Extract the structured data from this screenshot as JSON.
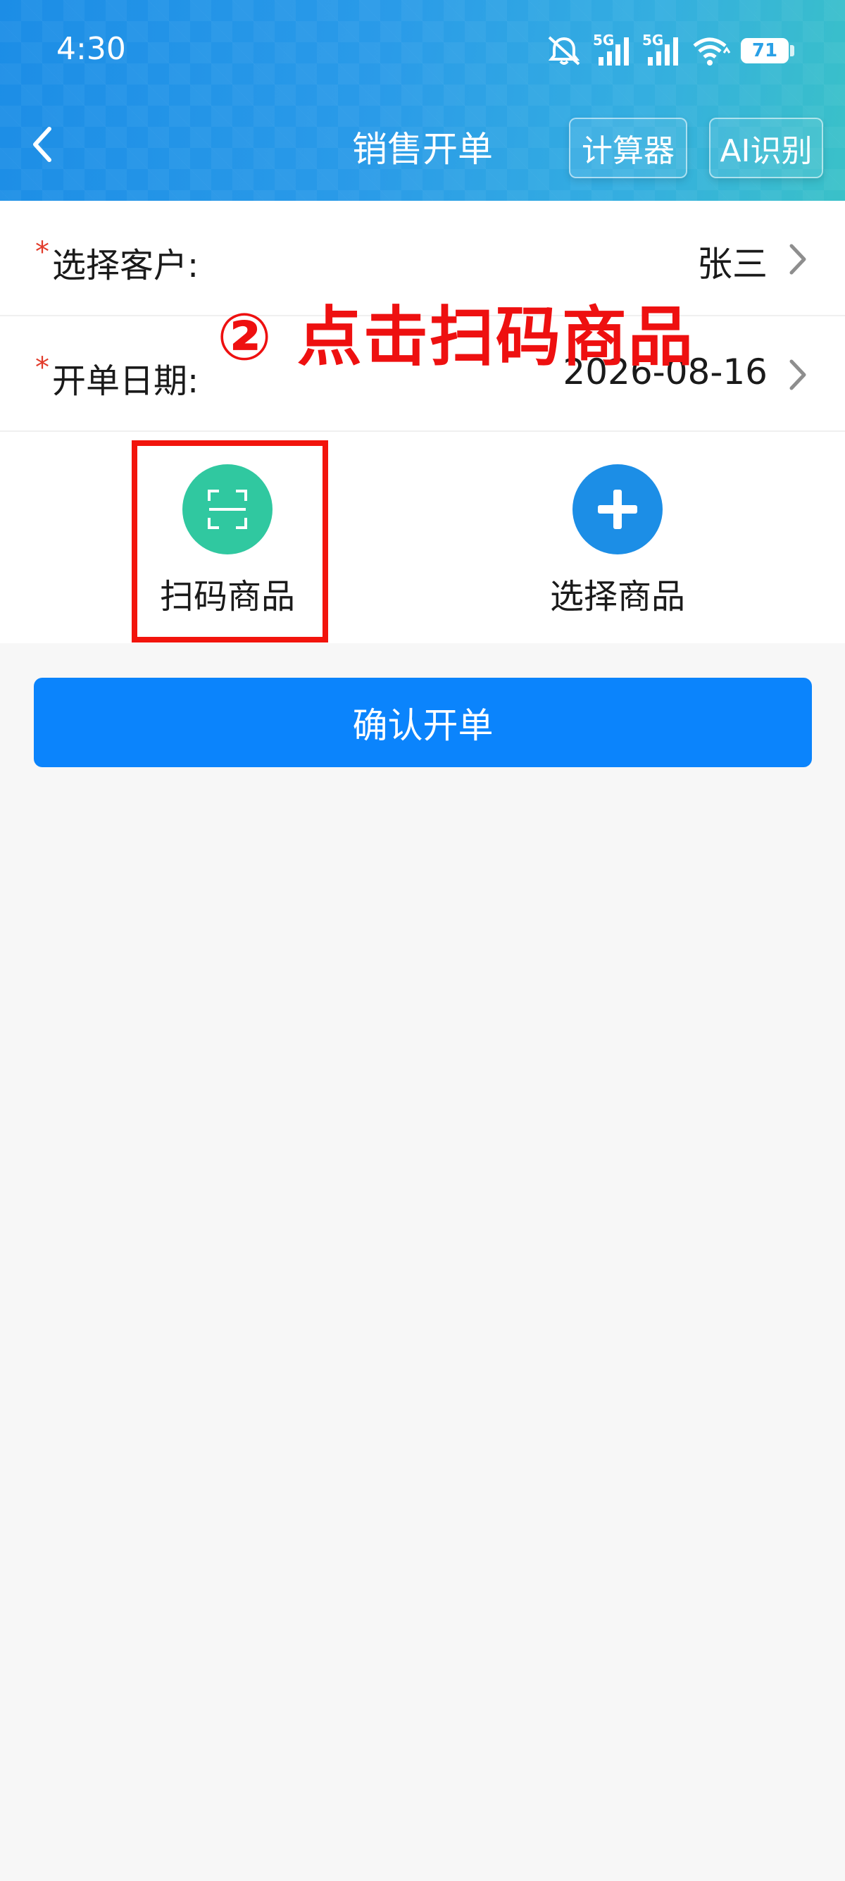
{
  "status_bar": {
    "time": "4:30",
    "signal_1_label": "5G",
    "signal_2_label": "5G",
    "battery": "71",
    "icons": [
      "mute-icon",
      "signal-5g-icon",
      "signal-5g-icon",
      "wifi-icon",
      "battery-icon"
    ]
  },
  "header": {
    "title": "销售开单",
    "back_icon": "chevron-left-icon",
    "calculator_label": "计算器",
    "ai_label": "AI识别"
  },
  "form": {
    "customer": {
      "required_mark": "*",
      "label": "选择客户:",
      "value": "张三"
    },
    "date": {
      "required_mark": "*",
      "label": "开单日期:",
      "value": "2026-08-16"
    }
  },
  "actions": {
    "scan": {
      "label": "扫码商品",
      "icon": "scan-icon",
      "color": "#30c8a0"
    },
    "choose": {
      "label": "选择商品",
      "icon": "plus-icon",
      "color": "#1c8ee6"
    }
  },
  "annotation": {
    "text": "② 点击扫码商品",
    "color": "#ee1010"
  },
  "confirm": {
    "label": "确认开单",
    "color": "#0b84fc"
  }
}
